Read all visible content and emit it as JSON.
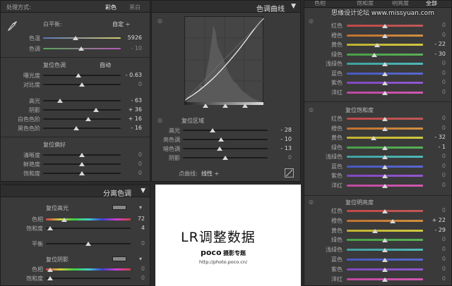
{
  "basic": {
    "treatment_label": "处理方式:",
    "color": "彩色",
    "bw": "黑白",
    "wb_label": "白平衡:",
    "wb_value": "自定 ÷",
    "temp_label": "色温",
    "temp_value": "5926",
    "tint_label": "色调",
    "tint_value": "- 10",
    "tone_title": "复位色调",
    "auto": "自动",
    "exposure_label": "曝光度",
    "exposure_value": "- 0.63",
    "contrast_label": "对比度",
    "contrast_value": "0",
    "highlights_label": "高光",
    "highlights_value": "- 63",
    "shadows_label": "阴影",
    "shadows_value": "+ 36",
    "whites_label": "白色色阶",
    "whites_value": "+ 16",
    "blacks_label": "黑色色阶",
    "blacks_value": "- 16",
    "presence_title": "复位偏好",
    "clarity_label": "清晰度",
    "clarity_value": "0",
    "vibrance_label": "鲜艳度",
    "vibrance_value": "0",
    "saturation_label": "饱和度",
    "saturation_value": "0"
  },
  "curve": {
    "title": "色调曲线",
    "region_title": "复位区域",
    "highlights_label": "高光",
    "highlights_value": "- 28",
    "lights_label": "亮色调",
    "lights_value": "- 10",
    "darks_label": "暗色调",
    "darks_value": "- 13",
    "shadows_label": "阴影",
    "shadows_value": "0",
    "point_curve_label": "点曲线:",
    "point_curve_value": "线性 ÷"
  },
  "split": {
    "title": "分离色调",
    "highlights_title": "复位高光",
    "hue_label": "色相",
    "hue_value": "72",
    "sat_label": "饱和度",
    "sat_value": "4",
    "balance_label": "平衡",
    "balance_value": "0",
    "shadows_title": "复位阴影",
    "sh_hue_label": "色相",
    "sh_hue_value": "0",
    "sh_sat_label": "饱和度",
    "sh_sat_value": "0"
  },
  "hsl": {
    "tabs": [
      "色相",
      "饱和度",
      "明亮度",
      "全部"
    ],
    "hue_rows": [
      {
        "label": "红色",
        "value": "0"
      },
      {
        "label": "橙色",
        "value": "0"
      },
      {
        "label": "黄色",
        "value": "- 22"
      },
      {
        "label": "绿色",
        "value": "- 30"
      },
      {
        "label": "浅绿色",
        "value": "0"
      },
      {
        "label": "蓝色",
        "value": "0"
      },
      {
        "label": "紫色",
        "value": "0"
      },
      {
        "label": "洋红",
        "value": "0"
      }
    ],
    "sat_title": "复位饱和度",
    "sat_rows": [
      {
        "label": "红色",
        "value": "0"
      },
      {
        "label": "橙色",
        "value": "0"
      },
      {
        "label": "黄色",
        "value": "- 32"
      },
      {
        "label": "绿色",
        "value": "- 1"
      },
      {
        "label": "浅绿色",
        "value": "0"
      },
      {
        "label": "蓝色",
        "value": "0"
      },
      {
        "label": "紫色",
        "value": "0"
      },
      {
        "label": "洋红",
        "value": "0"
      }
    ],
    "lum_title": "复位明亮度",
    "lum_rows": [
      {
        "label": "红色",
        "value": "0"
      },
      {
        "label": "橙色",
        "value": "+ 22"
      },
      {
        "label": "黄色",
        "value": "- 29"
      },
      {
        "label": "绿色",
        "value": "0"
      },
      {
        "label": "浅绿色",
        "value": "0"
      },
      {
        "label": "蓝色",
        "value": "0"
      },
      {
        "label": "紫色",
        "value": "0"
      },
      {
        "label": "洋红",
        "value": "0"
      }
    ]
  },
  "watermark_top": "思缘设计论坛 www.missyuan.com",
  "promo": {
    "title": "LR调整数据",
    "brand": "poco",
    "brand_sub": "摄影专题",
    "url": "http://photo.poco.cn/"
  }
}
